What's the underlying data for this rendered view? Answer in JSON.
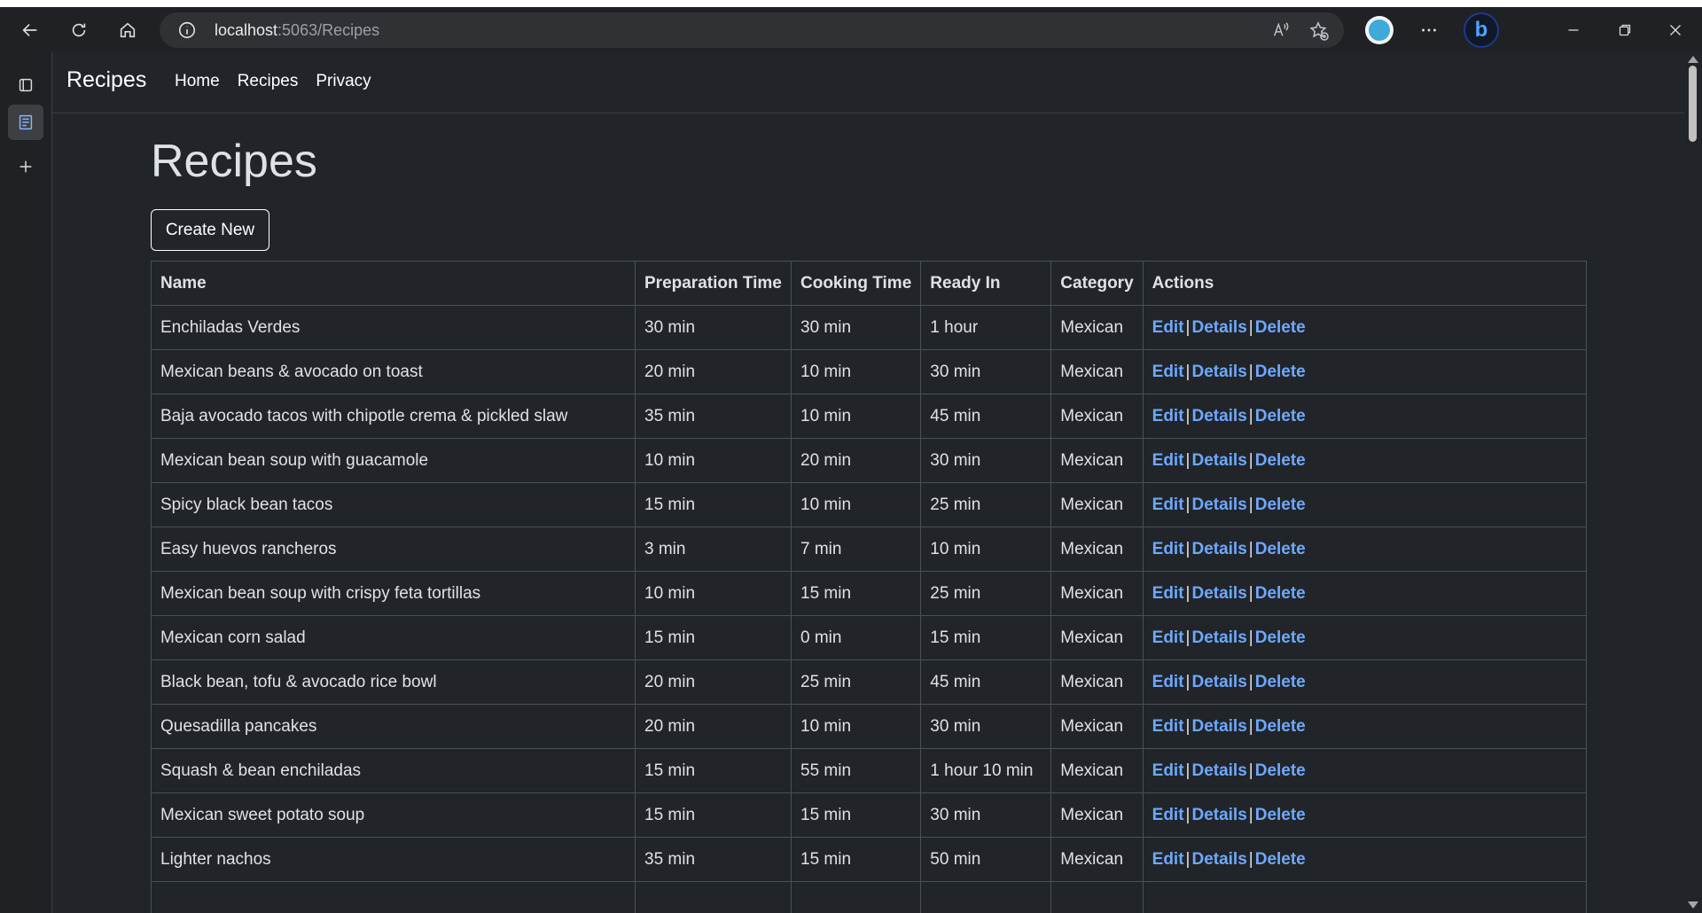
{
  "browser": {
    "url_host": "localhost",
    "url_path": ":5063/Recipes"
  },
  "site": {
    "brand": "Recipes",
    "nav": [
      "Home",
      "Recipes",
      "Privacy"
    ]
  },
  "page": {
    "title": "Recipes",
    "create_label": "Create New"
  },
  "table": {
    "headers": [
      "Name",
      "Preparation Time",
      "Cooking Time",
      "Ready In",
      "Category",
      "Actions"
    ],
    "action_labels": [
      "Edit",
      "Details",
      "Delete"
    ],
    "separator": "|",
    "rows": [
      [
        "Enchiladas Verdes",
        "30 min",
        "30 min",
        "1 hour",
        "Mexican"
      ],
      [
        "Mexican beans & avocado on toast",
        "20 min",
        "10 min",
        "30 min",
        "Mexican"
      ],
      [
        "Baja avocado tacos with chipotle crema & pickled slaw",
        "35 min",
        "10 min",
        "45 min",
        "Mexican"
      ],
      [
        "Mexican bean soup with guacamole",
        "10 min",
        "20 min",
        "30 min",
        "Mexican"
      ],
      [
        "Spicy black bean tacos",
        "15 min",
        "10 min",
        "25 min",
        "Mexican"
      ],
      [
        "Easy huevos rancheros",
        "3 min",
        "7 min",
        "10 min",
        "Mexican"
      ],
      [
        "Mexican bean soup with crispy feta tortillas",
        "10 min",
        "15 min",
        "25 min",
        "Mexican"
      ],
      [
        "Mexican corn salad",
        "15 min",
        "0 min",
        "15 min",
        "Mexican"
      ],
      [
        "Black bean, tofu & avocado rice bowl",
        "20 min",
        "25 min",
        "45 min",
        "Mexican"
      ],
      [
        "Quesadilla pancakes",
        "20 min",
        "10 min",
        "30 min",
        "Mexican"
      ],
      [
        "Squash & bean enchiladas",
        "15 min",
        "55 min",
        "1 hour 10 min",
        "Mexican"
      ],
      [
        "Mexican sweet potato soup",
        "15 min",
        "15 min",
        "30 min",
        "Mexican"
      ],
      [
        "Lighter nachos",
        "35 min",
        "15 min",
        "50 min",
        "Mexican"
      ],
      [
        "",
        "",
        "",
        "",
        ""
      ]
    ]
  },
  "colors": {
    "page_bg": "#212529",
    "link": "#6ea8fe",
    "border": "#495057"
  }
}
